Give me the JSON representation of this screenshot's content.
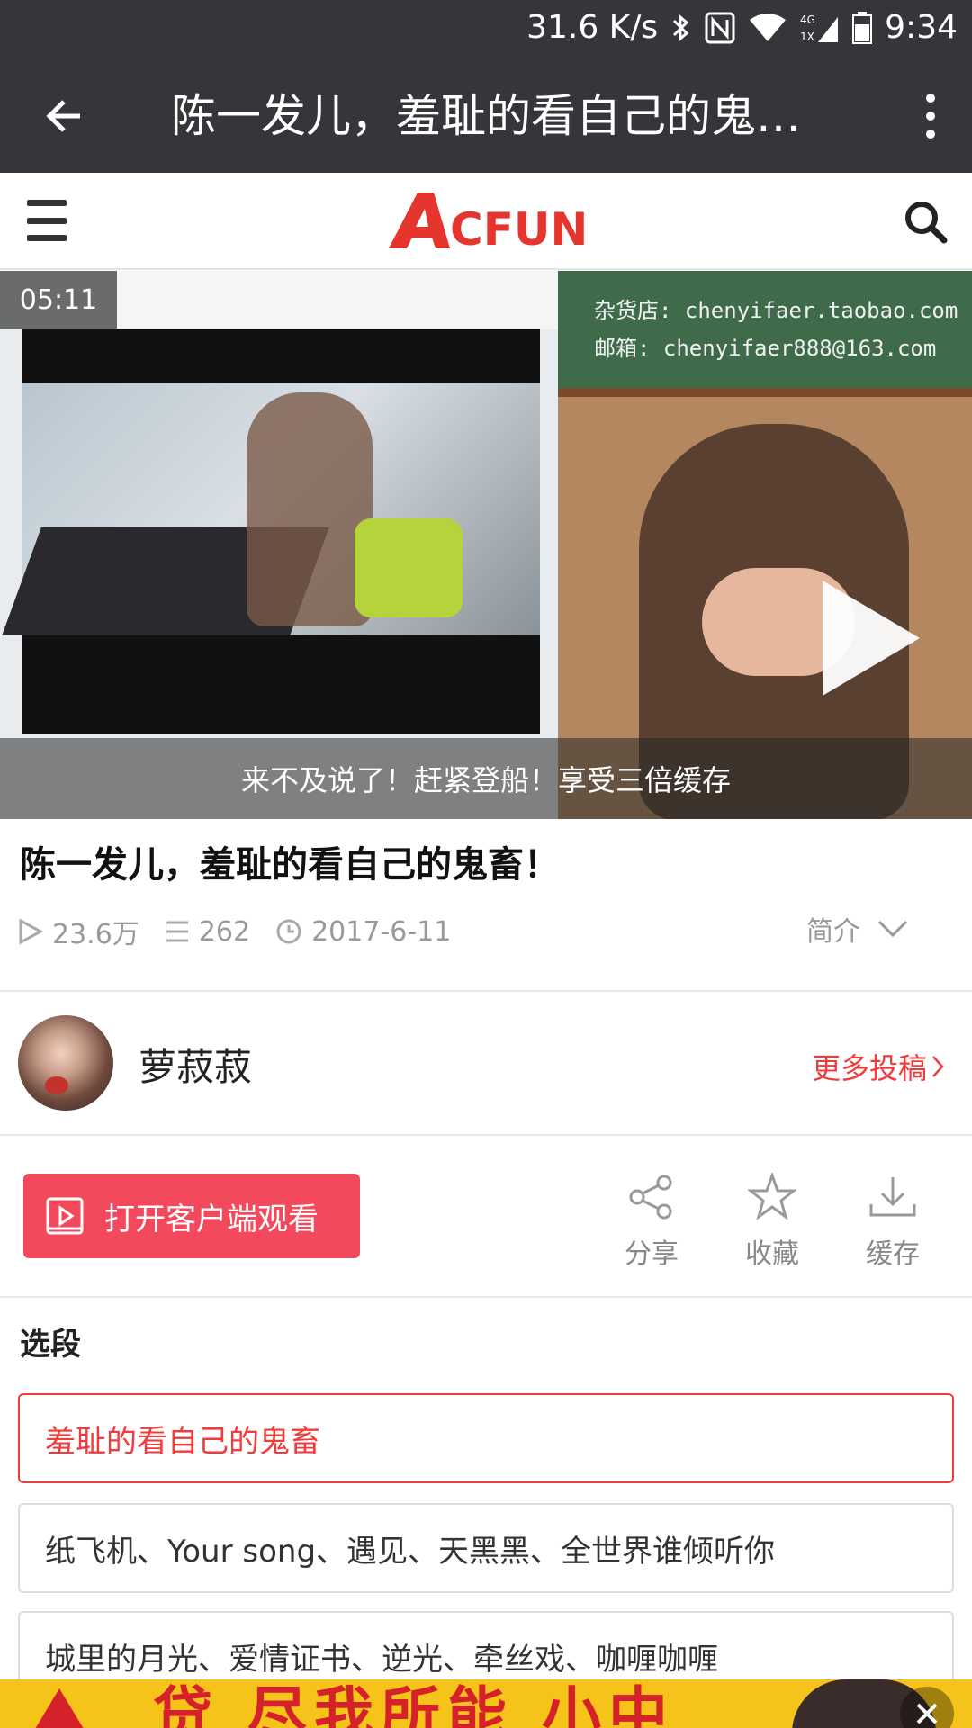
{
  "status_bar": {
    "net_speed": "31.6 K/s",
    "time": "9:34",
    "network_label": "4G"
  },
  "app_bar": {
    "title": "陈一发儿，羞耻的看自己的鬼…"
  },
  "site": {
    "logo_text": "AcFun",
    "brand_color": "#e6342f"
  },
  "video": {
    "duration": "05:11",
    "caption": "来不及说了！赶紧登船！享受三倍缓存",
    "board_line1": "杂货店: chenyifaer.taobao.com",
    "board_line2": "邮箱: chenyifaer888@163.com"
  },
  "video_info": {
    "title": "陈一发儿，羞耻的看自己的鬼畜！",
    "views": "23.6万",
    "danmaku": "262",
    "date": "2017-6-11",
    "intro_label": "简介"
  },
  "uploader": {
    "name": "萝菽菽",
    "more_link": "更多投稿"
  },
  "actions": {
    "open_app": "打开客户端观看",
    "share": "分享",
    "favorite": "收藏",
    "cache": "缓存"
  },
  "episodes": {
    "title": "选段",
    "items": [
      {
        "label": "羞耻的看自己的鬼畜"
      },
      {
        "label": "纸飞机、Your song、遇见、天黑黑、全世界谁倾听你"
      },
      {
        "label": "城里的月光、爱情证书、逆光、牵丝戏、咖喱咖喱"
      }
    ]
  },
  "ad": {
    "text": "贷 尽我所能 小中"
  },
  "colors": {
    "appbar_bg": "#36363a",
    "accent_red": "#f23b3b",
    "open_button_bg": "#f3495d"
  }
}
